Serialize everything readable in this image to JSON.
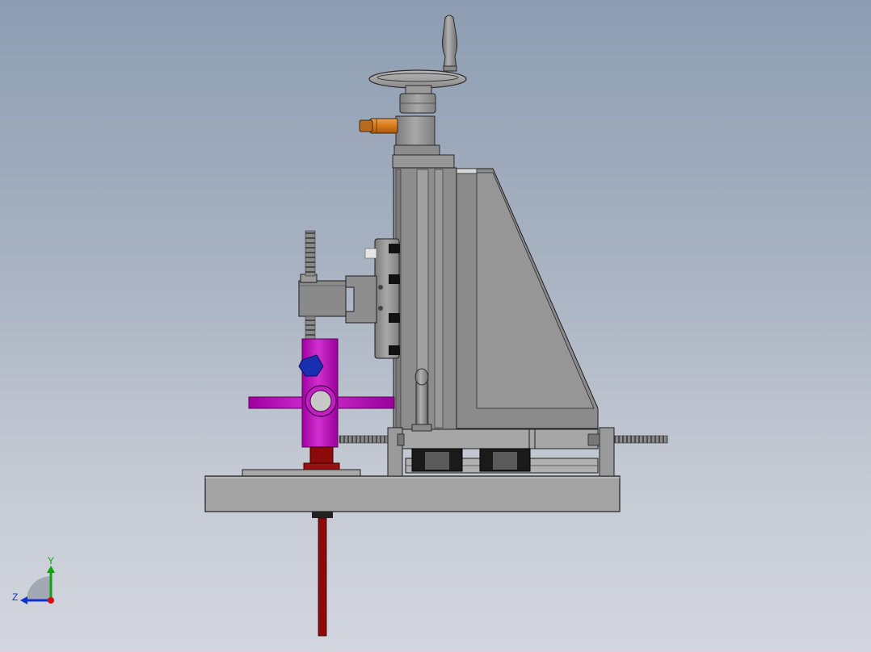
{
  "view": {
    "colors": {
      "background_top": "#8e9db2",
      "background_bottom": "#d3d6de",
      "steel": "#9a9a9a",
      "steel_light": "#b5b5b5",
      "steel_dark": "#6e6e6e",
      "clamp_part": "#c000c0",
      "pin_part": "#8b0a0a",
      "tip_part": "#1a2fb0",
      "knob_part": "#d97a1a",
      "outline": "#1e1e1e"
    }
  },
  "triad": {
    "y_label": "Y",
    "z_label": "Z",
    "colors": {
      "x_axis": "#d01010",
      "y_axis": "#10a010",
      "z_axis": "#1030d0"
    }
  }
}
